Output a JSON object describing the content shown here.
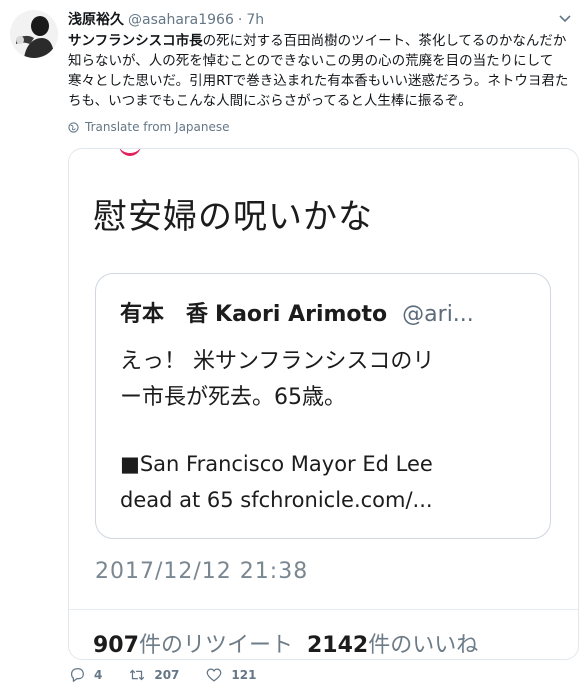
{
  "tweet": {
    "author_name": "浅原裕久",
    "handle": "@asahara1966",
    "separator": "·",
    "time": "7h",
    "text_bold": "サンフランシスコ市長",
    "text_rest": "の死に対する百田尚樹のツイート、茶化してるのかなんだか知らないが、人の死を悼むことのできないこの男の心の荒廃を目の当たりにして寒々とした思いだ。引用RTで巻き込まれた有本香もいい迷惑だろう。ネトウヨ君たちも、いつまでもこんな人間にぶらさがってると人生棒に振るぞ。",
    "translate_label": "Translate from Japanese"
  },
  "screenshot": {
    "title": "慰安婦の呪いかな",
    "inner_author_name": "有本　香",
    "inner_author_en": "Kaori Arimoto",
    "inner_handle": "@ari...",
    "inner_text_line1": "えっ！ 米サンフランシスコのリ",
    "inner_text_line2": "ー市長が死去。65歳。",
    "inner_link_line1": "■San Francisco Mayor Ed Lee",
    "inner_link_line2": "dead at 65 sfchronicle.com/...",
    "date": "2017/12/12 21:38",
    "retweets_num": "907",
    "retweets_label": "件のリツイート",
    "likes_num": "2142",
    "likes_label": "件のいいね"
  },
  "actions": {
    "reply_count": "4",
    "retweet_count": "207",
    "like_count": "121"
  },
  "colors": {
    "text": "#14171a",
    "muted": "#657786",
    "border": "#e1e8ed",
    "red": "#e0245e"
  },
  "icons": [
    "avatar",
    "caret-down-icon",
    "globe-icon",
    "reply-icon",
    "retweet-icon",
    "heart-icon"
  ]
}
